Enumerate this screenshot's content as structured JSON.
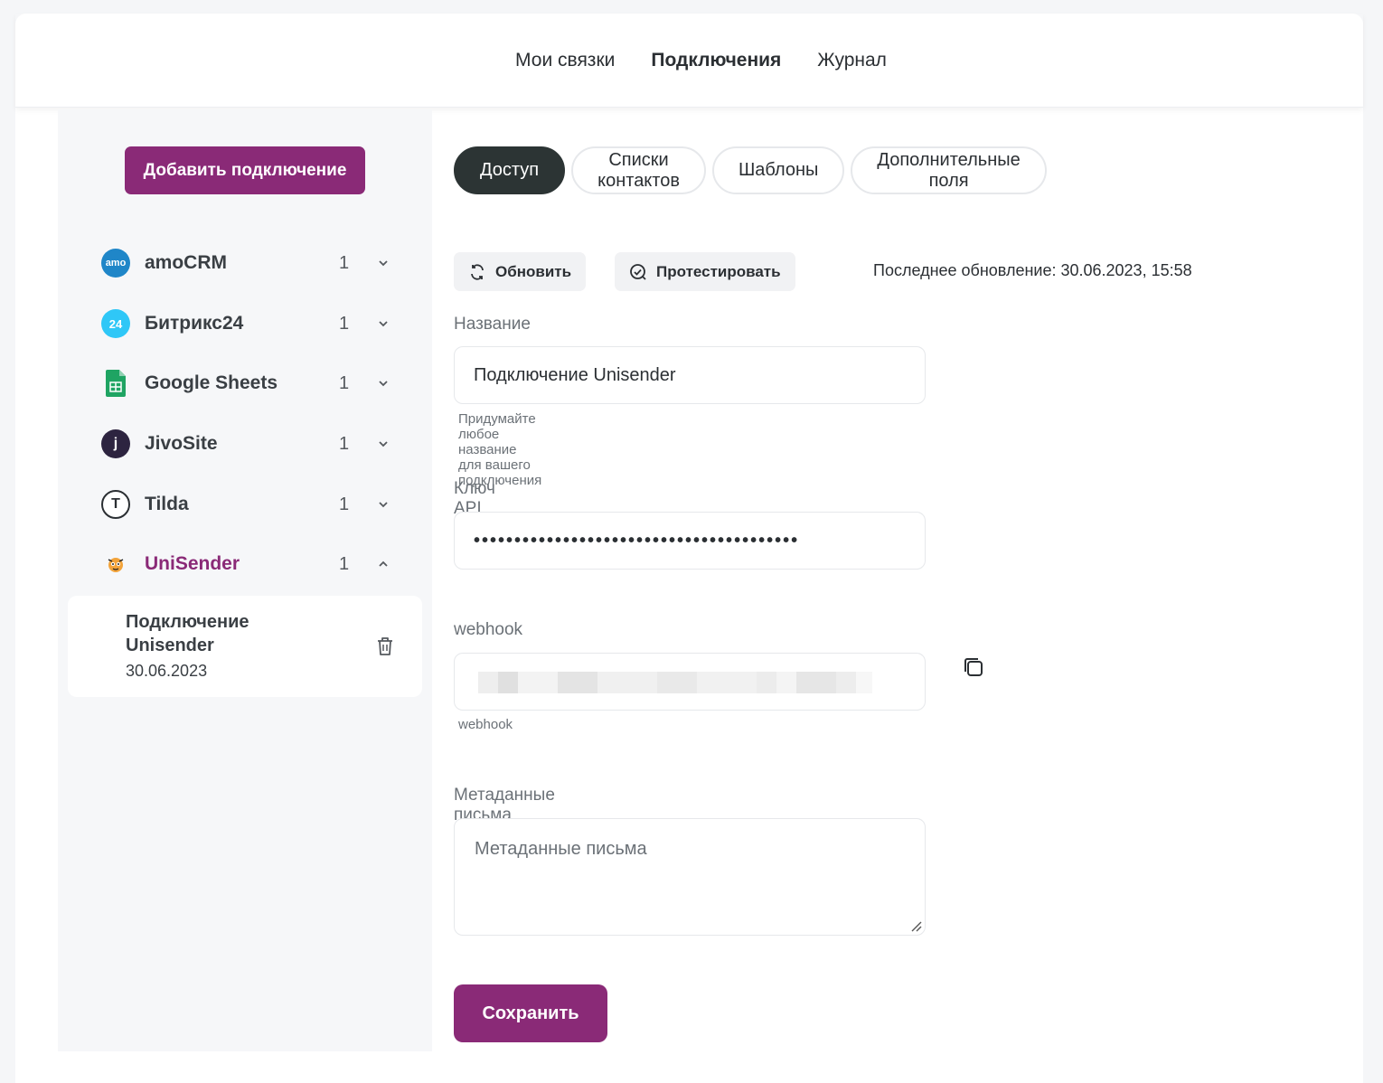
{
  "topnav": {
    "items": [
      {
        "label": "Мои связки",
        "active": false
      },
      {
        "label": "Подключения",
        "active": true
      },
      {
        "label": "Журнал",
        "active": false
      }
    ]
  },
  "sidebar": {
    "add_button": "Добавить подключение",
    "services": [
      {
        "name": "amoCRM",
        "count": "1",
        "icon": "amocrm-logo-icon",
        "logo_text": "amo",
        "color": "#1f86c8",
        "expanded": false
      },
      {
        "name": "Битрикс24",
        "count": "1",
        "icon": "bitrix24-logo-icon",
        "logo_text": "24",
        "color": "#2fc7f7",
        "expanded": false
      },
      {
        "name": "Google Sheets",
        "count": "1",
        "icon": "google-sheets-logo-icon",
        "logo_text": "",
        "color": "#1fa463",
        "expanded": false
      },
      {
        "name": "JivoSite",
        "count": "1",
        "icon": "jivosite-logo-icon",
        "logo_text": "j",
        "color": "#2d2440",
        "expanded": false
      },
      {
        "name": "Tilda",
        "count": "1",
        "icon": "tilda-logo-icon",
        "logo_text": "T",
        "color": "#ffffff",
        "expanded": false
      },
      {
        "name": "UniSender",
        "count": "1",
        "icon": "unisender-logo-icon",
        "logo_text": "",
        "color": "#f2a33a",
        "expanded": true
      }
    ],
    "connection": {
      "title": "Подключение Unisender",
      "date": "30.06.2023"
    }
  },
  "main": {
    "tabs": [
      {
        "label": "Доступ",
        "active": true
      },
      {
        "label": "Списки контактов",
        "active": false
      },
      {
        "label": "Шаблоны",
        "active": false
      },
      {
        "label": "Дополнительные поля",
        "active": false
      }
    ],
    "refresh_label": "Обновить",
    "test_label": "Протестировать",
    "last_update": "Последнее обновление: 30.06.2023, 15:58",
    "name": {
      "label": "Название",
      "value": "Подключение Unisender",
      "hint": "Придумайте любое название для вашего подключения"
    },
    "api_key": {
      "label": "Ключ API",
      "value": "••••••••••••••••••••••••••••••••••••••••"
    },
    "webhook": {
      "label": "webhook",
      "hint": "webhook"
    },
    "metadata": {
      "label": "Метаданные письма",
      "placeholder": "Метаданные письма"
    },
    "save_label": "Сохранить"
  },
  "colors": {
    "accent": "#8a2a77",
    "active_tab": "#2c3434"
  }
}
